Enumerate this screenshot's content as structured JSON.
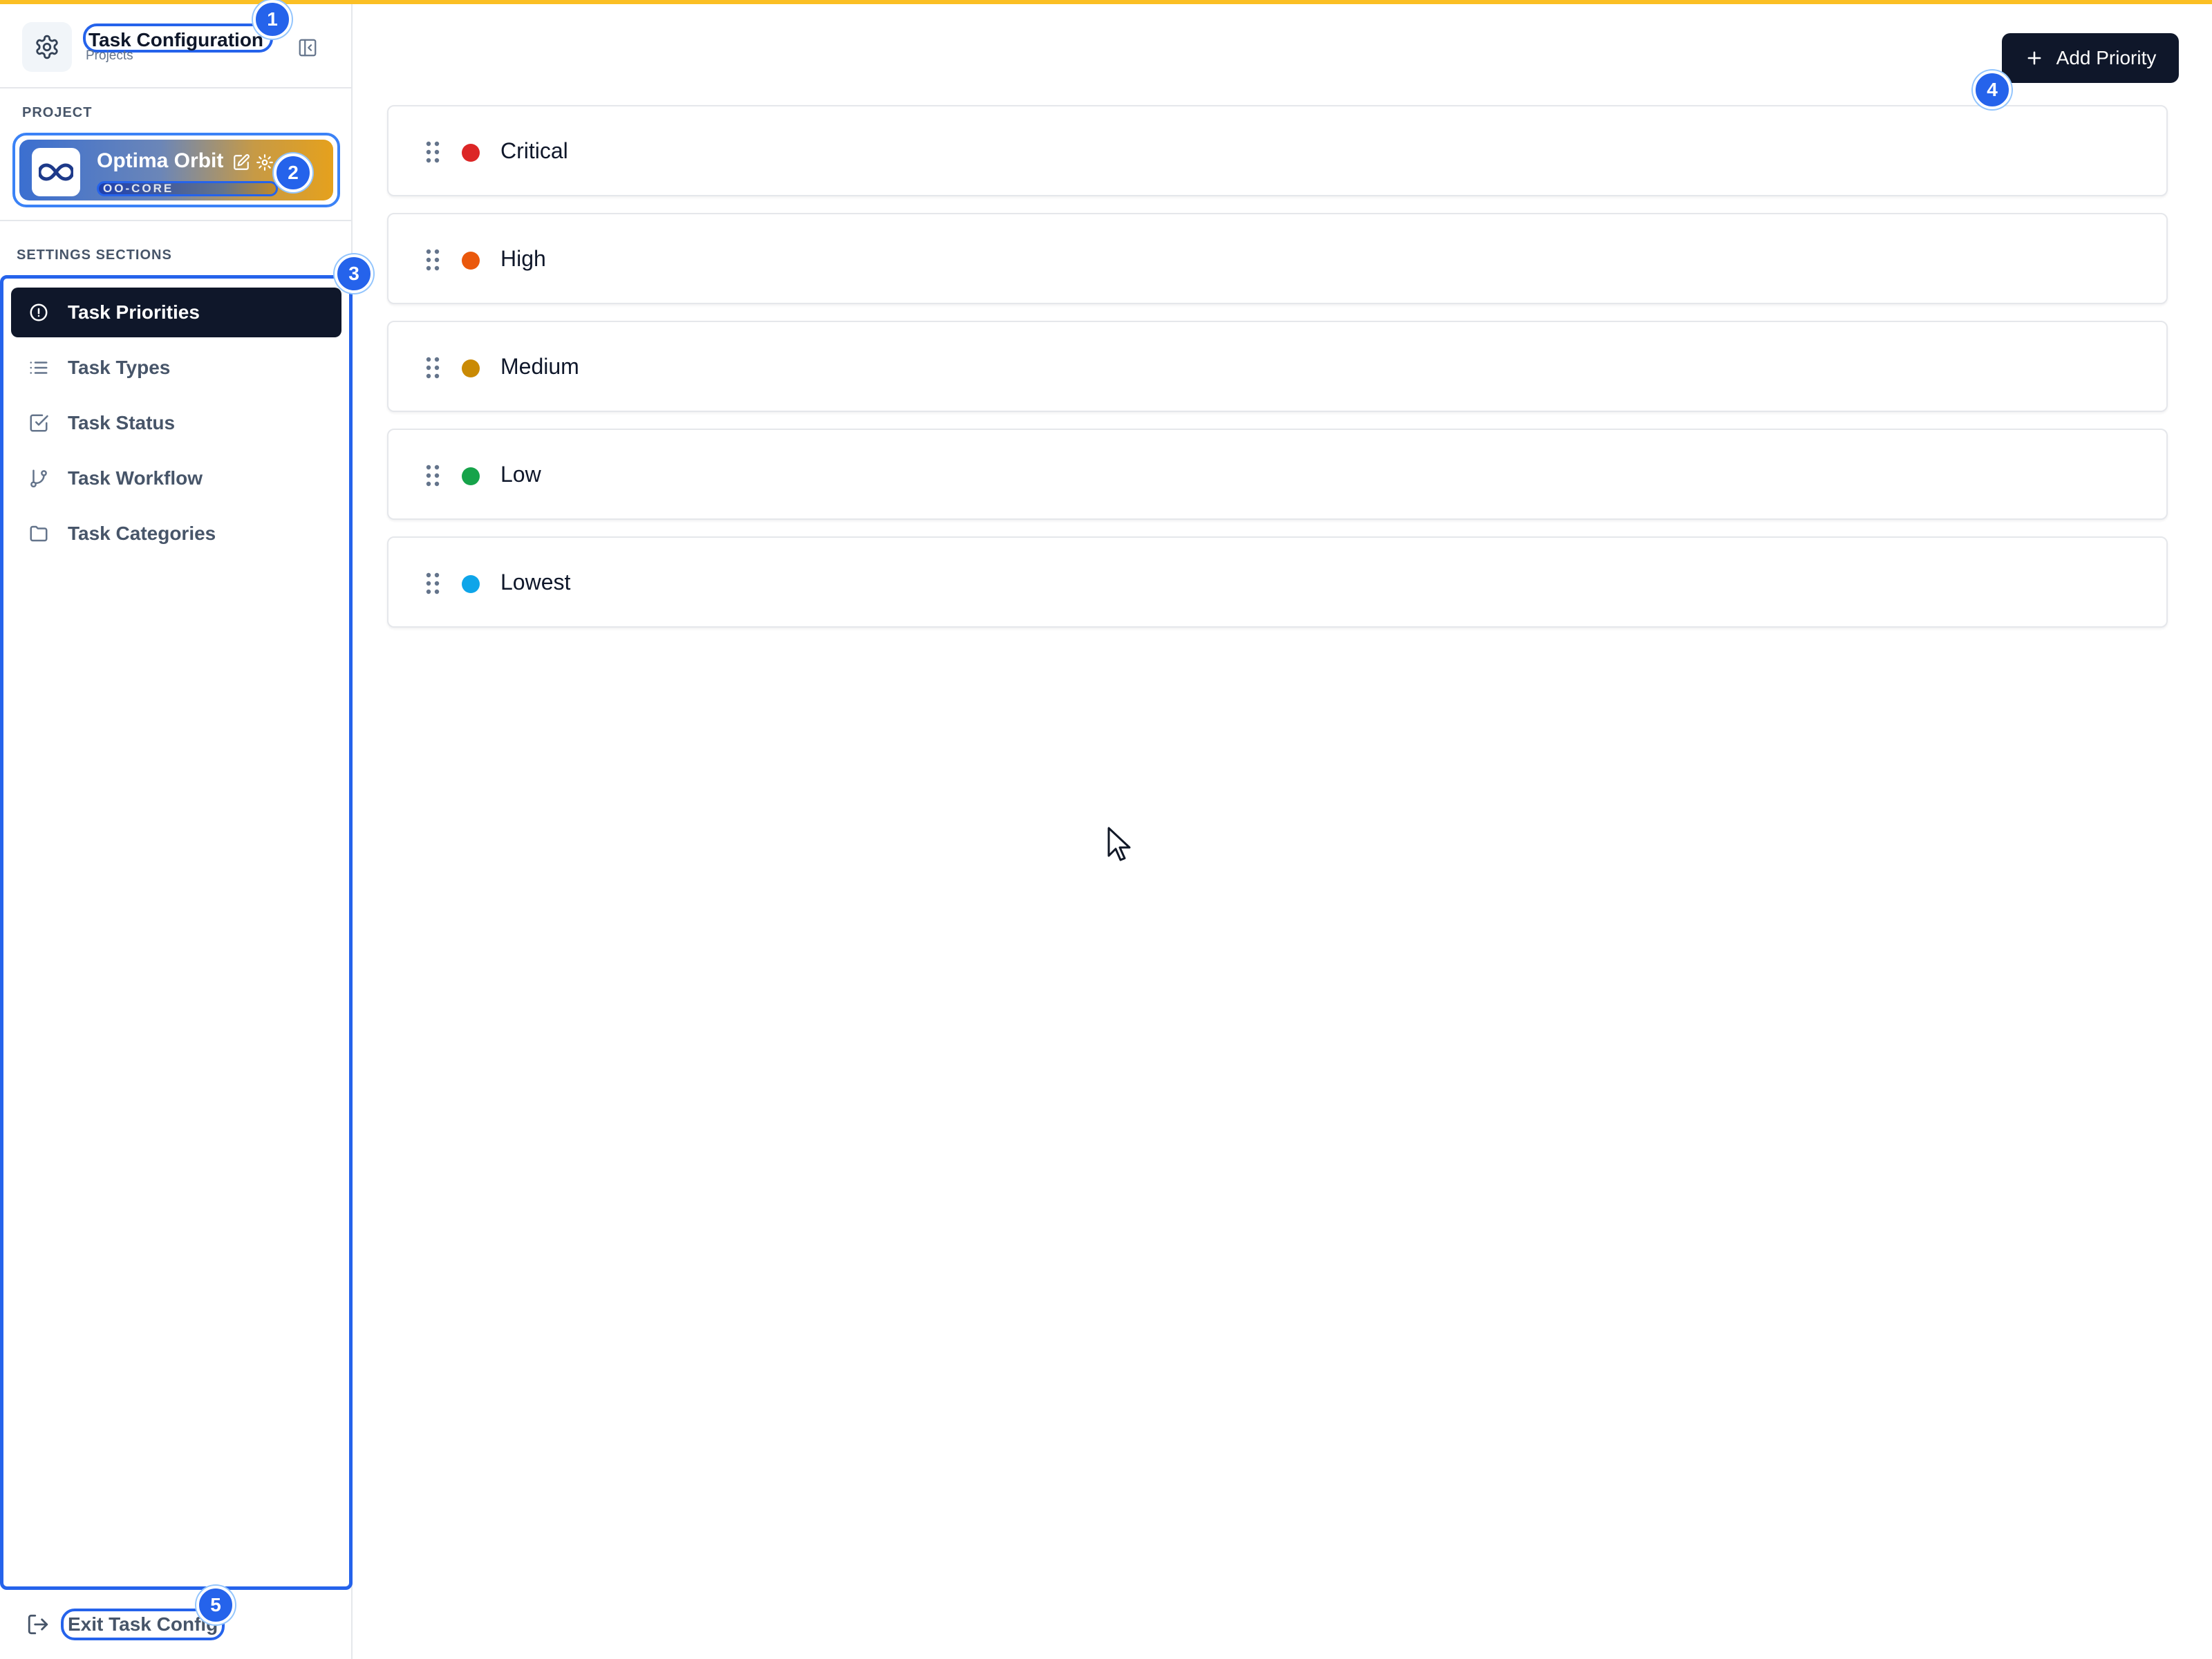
{
  "header": {
    "title": "Task Configuration",
    "subtitle": "Projects"
  },
  "project_section": {
    "label": "PROJECT",
    "name": "Optima Orbit",
    "code": "OO-CORE"
  },
  "settings": {
    "label": "SETTINGS SECTIONS",
    "items": [
      {
        "label": "Task Priorities",
        "icon": "alert-circle-icon",
        "active": true
      },
      {
        "label": "Task Types",
        "icon": "list-icon",
        "active": false
      },
      {
        "label": "Task Status",
        "icon": "check-square-icon",
        "active": false
      },
      {
        "label": "Task Workflow",
        "icon": "git-branch-icon",
        "active": false
      },
      {
        "label": "Task Categories",
        "icon": "folder-icon",
        "active": false
      }
    ]
  },
  "exit": {
    "label": "Exit Task Config"
  },
  "main": {
    "add_button_label": "Add Priority",
    "priorities": [
      {
        "label": "Critical",
        "color": "#dc2626"
      },
      {
        "label": "High",
        "color": "#ea580c"
      },
      {
        "label": "Medium",
        "color": "#ca8a04"
      },
      {
        "label": "Low",
        "color": "#16a34a"
      },
      {
        "label": "Lowest",
        "color": "#0ea5e9"
      }
    ]
  },
  "annotations": [
    "1",
    "2",
    "3",
    "4",
    "5"
  ],
  "colors": {
    "accent_bar": "#fbbf24",
    "primary_dark": "#0f172a",
    "highlight_blue": "#2563eb"
  }
}
